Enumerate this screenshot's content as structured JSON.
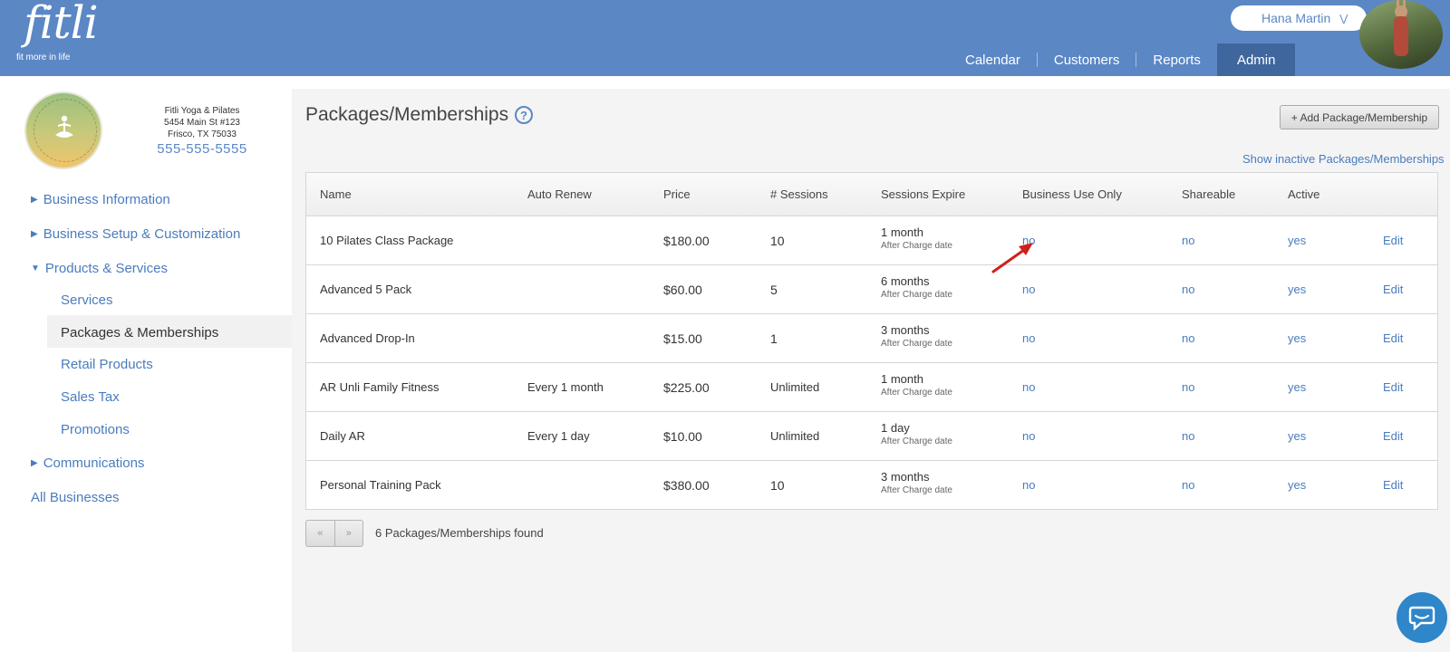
{
  "header": {
    "logo_text": "fitli",
    "logo_tagline": "fit more in life",
    "user_name": "Hana Martin",
    "nav": [
      "Calendar",
      "Customers",
      "Reports",
      "Admin"
    ],
    "active_nav": "Admin",
    "brand_color": "#5b87c5"
  },
  "sidebar": {
    "business": {
      "name": "Fitli Yoga & Pilates",
      "address1": "5454 Main St #123",
      "address2": "Frisco, TX 75033",
      "phone": "555-555-5555",
      "logo_text": "FITLI YOGA & PILATES"
    },
    "menu": {
      "business_information": "Business Information",
      "business_setup": "Business Setup & Customization",
      "products_services": "Products & Services",
      "services": "Services",
      "packages_memberships": "Packages & Memberships",
      "retail_products": "Retail Products",
      "sales_tax": "Sales Tax",
      "promotions": "Promotions",
      "communications": "Communications",
      "all_businesses": "All Businesses"
    }
  },
  "main": {
    "title": "Packages/Memberships",
    "help_icon": "?",
    "add_button": "+ Add Package/Membership",
    "show_inactive": "Show inactive Packages/Memberships",
    "columns": [
      "Name",
      "Auto Renew",
      "Price",
      "# Sessions",
      "Sessions Expire",
      "Business Use Only",
      "Shareable",
      "Active"
    ],
    "rows": [
      {
        "name": "10 Pilates Class Package",
        "auto_renew": "",
        "price": "$180.00",
        "sessions": "10",
        "expire": "1 month",
        "expire_sub": "After Charge date",
        "business_use_only": "no",
        "shareable": "no",
        "active": "yes",
        "edit": "Edit"
      },
      {
        "name": "Advanced 5 Pack",
        "auto_renew": "",
        "price": "$60.00",
        "sessions": "5",
        "expire": "6 months",
        "expire_sub": "After Charge date",
        "business_use_only": "no",
        "shareable": "no",
        "active": "yes",
        "edit": "Edit"
      },
      {
        "name": "Advanced Drop-In",
        "auto_renew": "",
        "price": "$15.00",
        "sessions": "1",
        "expire": "3 months",
        "expire_sub": "After Charge date",
        "business_use_only": "no",
        "shareable": "no",
        "active": "yes",
        "edit": "Edit"
      },
      {
        "name": "AR Unli Family Fitness",
        "auto_renew": "Every 1 month",
        "price": "$225.00",
        "sessions": "Unlimited",
        "expire": "1 month",
        "expire_sub": "After Charge date",
        "business_use_only": "no",
        "shareable": "no",
        "active": "yes",
        "edit": "Edit"
      },
      {
        "name": "Daily AR",
        "auto_renew": "Every 1 day",
        "price": "$10.00",
        "sessions": "Unlimited",
        "expire": "1 day",
        "expire_sub": "After Charge date",
        "business_use_only": "no",
        "shareable": "no",
        "active": "yes",
        "edit": "Edit"
      },
      {
        "name": "Personal Training Pack",
        "auto_renew": "",
        "price": "$380.00",
        "sessions": "10",
        "expire": "3 months",
        "expire_sub": "After Charge date",
        "business_use_only": "no",
        "shareable": "no",
        "active": "yes",
        "edit": "Edit"
      }
    ],
    "pager": {
      "prev": "«",
      "next": "»"
    },
    "found_text": "6 Packages/Memberships found",
    "annotation": "red-arrow-icon",
    "chat": "chat-icon"
  }
}
